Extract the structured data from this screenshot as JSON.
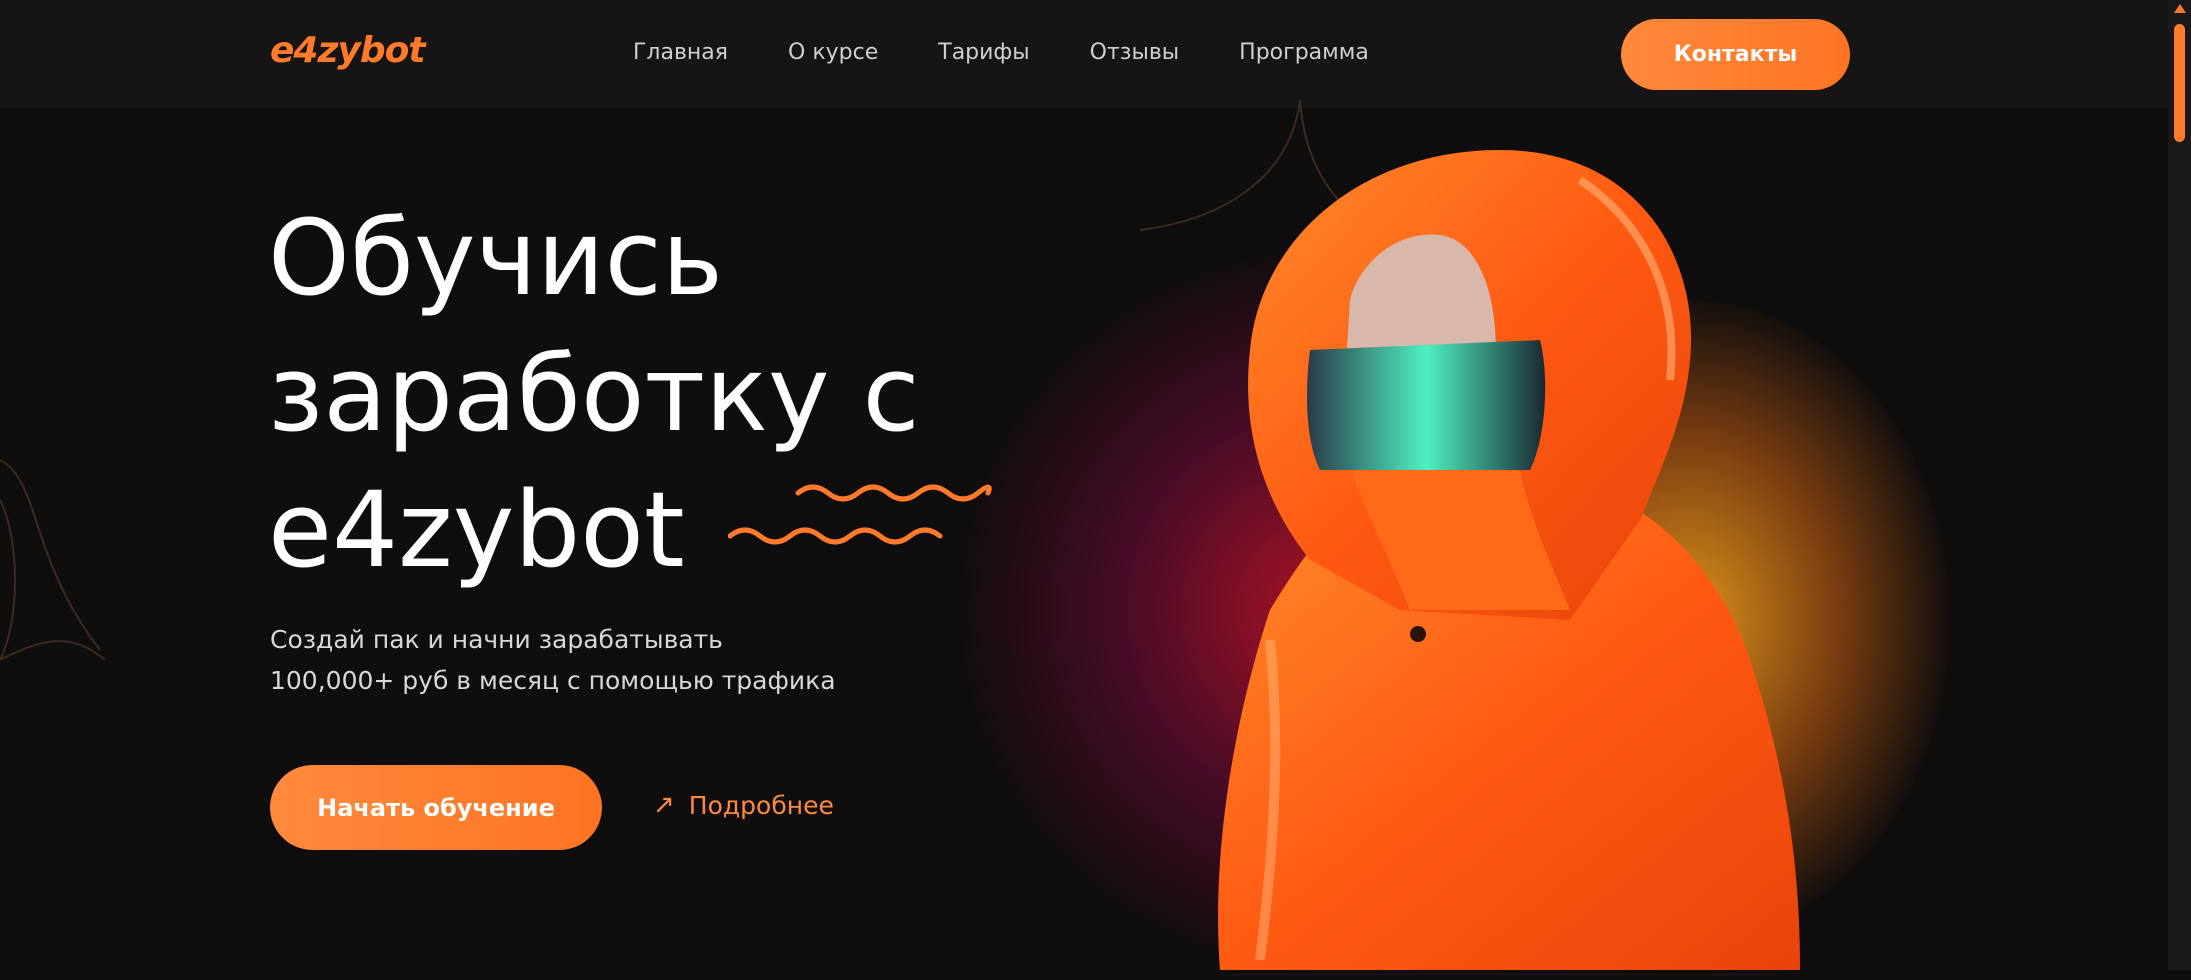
{
  "header": {
    "logo": "e4zybot",
    "nav": [
      "Главная",
      "О курсе",
      "Тарифы",
      "Отзывы",
      "Программа"
    ],
    "contacts_label": "Контакты"
  },
  "hero": {
    "title_lines": [
      "Обучись",
      "заработку с",
      "e4zybot"
    ],
    "subtitle_lines": [
      "Создай пак и начни зарабатывать",
      "100,000+ руб в месяц с помощью трафика"
    ],
    "start_label": "Начать обучение",
    "more_label": "Подробнее",
    "more_icon": "arrow-up-right-icon"
  },
  "colors": {
    "accent": "#ff7a2a",
    "background": "#0f0d0d",
    "header_bg": "#161414"
  }
}
